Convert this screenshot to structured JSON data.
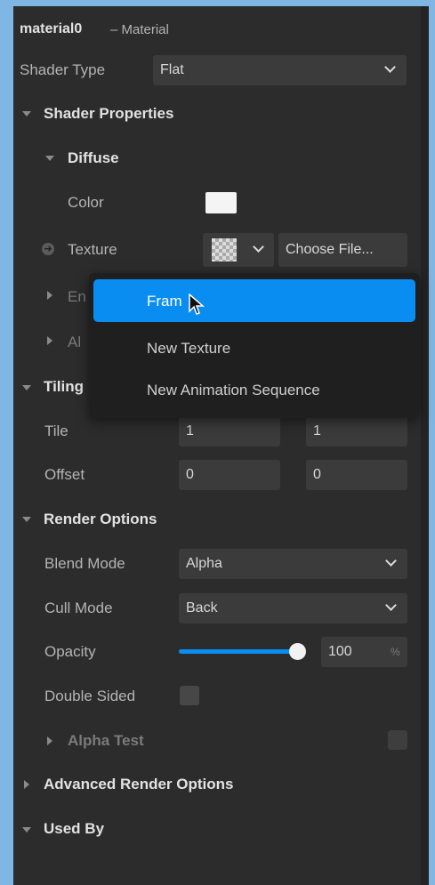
{
  "header": {
    "name": "material0",
    "type": "– Material"
  },
  "shader_type": {
    "label": "Shader Type",
    "value": "Flat"
  },
  "sections": {
    "shader_properties": "Shader Properties",
    "diffuse": "Diffuse",
    "color_label": "Color",
    "texture_label": "Texture",
    "choose_file": "Choose File...",
    "env_partial": "En",
    "al_partial": "Al",
    "tiling": "Tiling",
    "tile": "Tile",
    "offset": "Offset",
    "render_options": "Render Options",
    "blend_mode": "Blend Mode",
    "cull_mode": "Cull Mode",
    "opacity": "Opacity",
    "double_sided": "Double Sided",
    "alpha_test": "Alpha Test",
    "advanced_render_options": "Advanced Render Options",
    "used_by": "Used By"
  },
  "values": {
    "tile_x": "1",
    "tile_y": "1",
    "offset_x": "0",
    "offset_y": "0",
    "blend_mode": "Alpha",
    "cull_mode": "Back",
    "opacity": "100",
    "opacity_unit": "%",
    "opacity_fraction": 1.0
  },
  "dropdown_menu": {
    "items": [
      "Fram",
      "New Texture",
      "New Animation Sequence"
    ],
    "highlighted_index": 0
  },
  "colors": {
    "accent": "#0a8df0",
    "panel_bg": "#2c2c2c",
    "page_bg": "#7fb6e4"
  }
}
